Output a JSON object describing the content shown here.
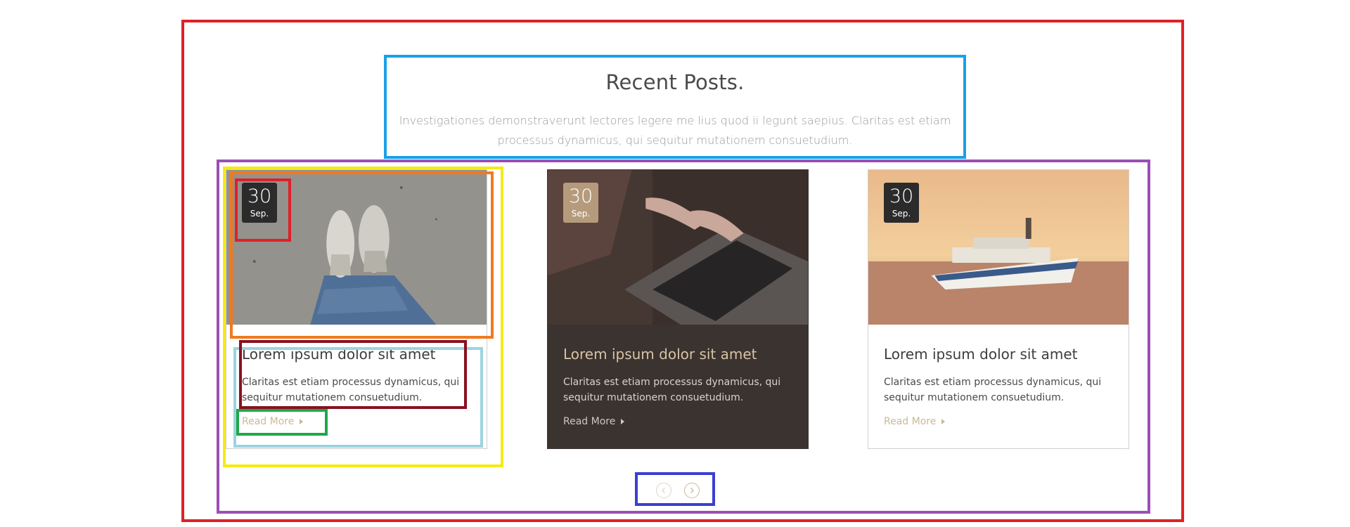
{
  "section": {
    "heading": "Recent Posts.",
    "subtext": "Investigationes demonstraverunt lectores legere me lius quod ii legunt saepius. Claritas est etiam processus dynamicus, qui sequitur mutationem consuetudium."
  },
  "posts": [
    {
      "day": "30",
      "month": "Sep.",
      "title": "Lorem ipsum dolor sit amet",
      "excerpt": "Claritas est etiam processus dynamicus, qui sequitur mutationem consuetudium.",
      "read_more": "Read More",
      "image": "feet-on-sand-photo"
    },
    {
      "day": "30",
      "month": "Sep.",
      "title": "Lorem ipsum dolor sit amet",
      "excerpt": "Claritas est etiam processus dynamicus, qui sequitur mutationem consuetudium.",
      "read_more": "Read More",
      "image": "typing-on-laptop-photo"
    },
    {
      "day": "30",
      "month": "Sep.",
      "title": "Lorem ipsum dolor sit amet",
      "excerpt": "Claritas est etiam processus dynamicus, qui sequitur mutationem consuetudium.",
      "read_more": "Read More",
      "image": "cruise-ship-sunset-photo"
    }
  ],
  "carousel": {
    "prev_icon": "chevron-left-icon",
    "next_icon": "chevron-right-icon"
  },
  "colors": {
    "accent": "#cdb896",
    "dark_card": "#3a332f",
    "date_badge": "#2b2b2b",
    "date_badge_active": "#b59b7c",
    "annotation_red": "#e02028",
    "annotation_blue": "#1aa0e8",
    "annotation_purple": "#9b4fb3",
    "annotation_yellow": "#f5ea14",
    "annotation_orange": "#f07a1e",
    "annotation_lightblue": "#9dd3e0",
    "annotation_darkred": "#8a1020",
    "annotation_green": "#1fa84a",
    "annotation_navy": "#3a3fd0"
  }
}
